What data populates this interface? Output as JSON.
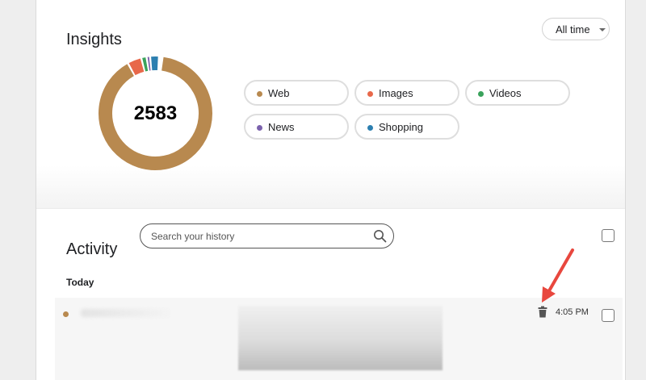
{
  "insights": {
    "title": "Insights",
    "range_dropdown": {
      "selected": "All time"
    },
    "total": "2583",
    "breakdown_fractions": {
      "Web": 0.9,
      "Images": 0.04,
      "Videos": 0.015,
      "News": 0.01,
      "Shopping": 0.025
    },
    "categories": [
      {
        "label": "Web",
        "color": "#b8894f"
      },
      {
        "label": "Images",
        "color": "#e8684a"
      },
      {
        "label": "Videos",
        "color": "#3aa25b"
      },
      {
        "label": "News",
        "color": "#7b62ad"
      },
      {
        "label": "Shopping",
        "color": "#2c7fb0"
      }
    ]
  },
  "activity": {
    "title": "Activity",
    "search": {
      "placeholder": "Search your history",
      "value": ""
    },
    "groups": [
      {
        "label": "Today",
        "items": [
          {
            "category_color": "#b8894f",
            "time": "4:05 PM",
            "checked": false
          }
        ]
      }
    ]
  },
  "annotation": {
    "arrow_color": "#e8473e"
  }
}
